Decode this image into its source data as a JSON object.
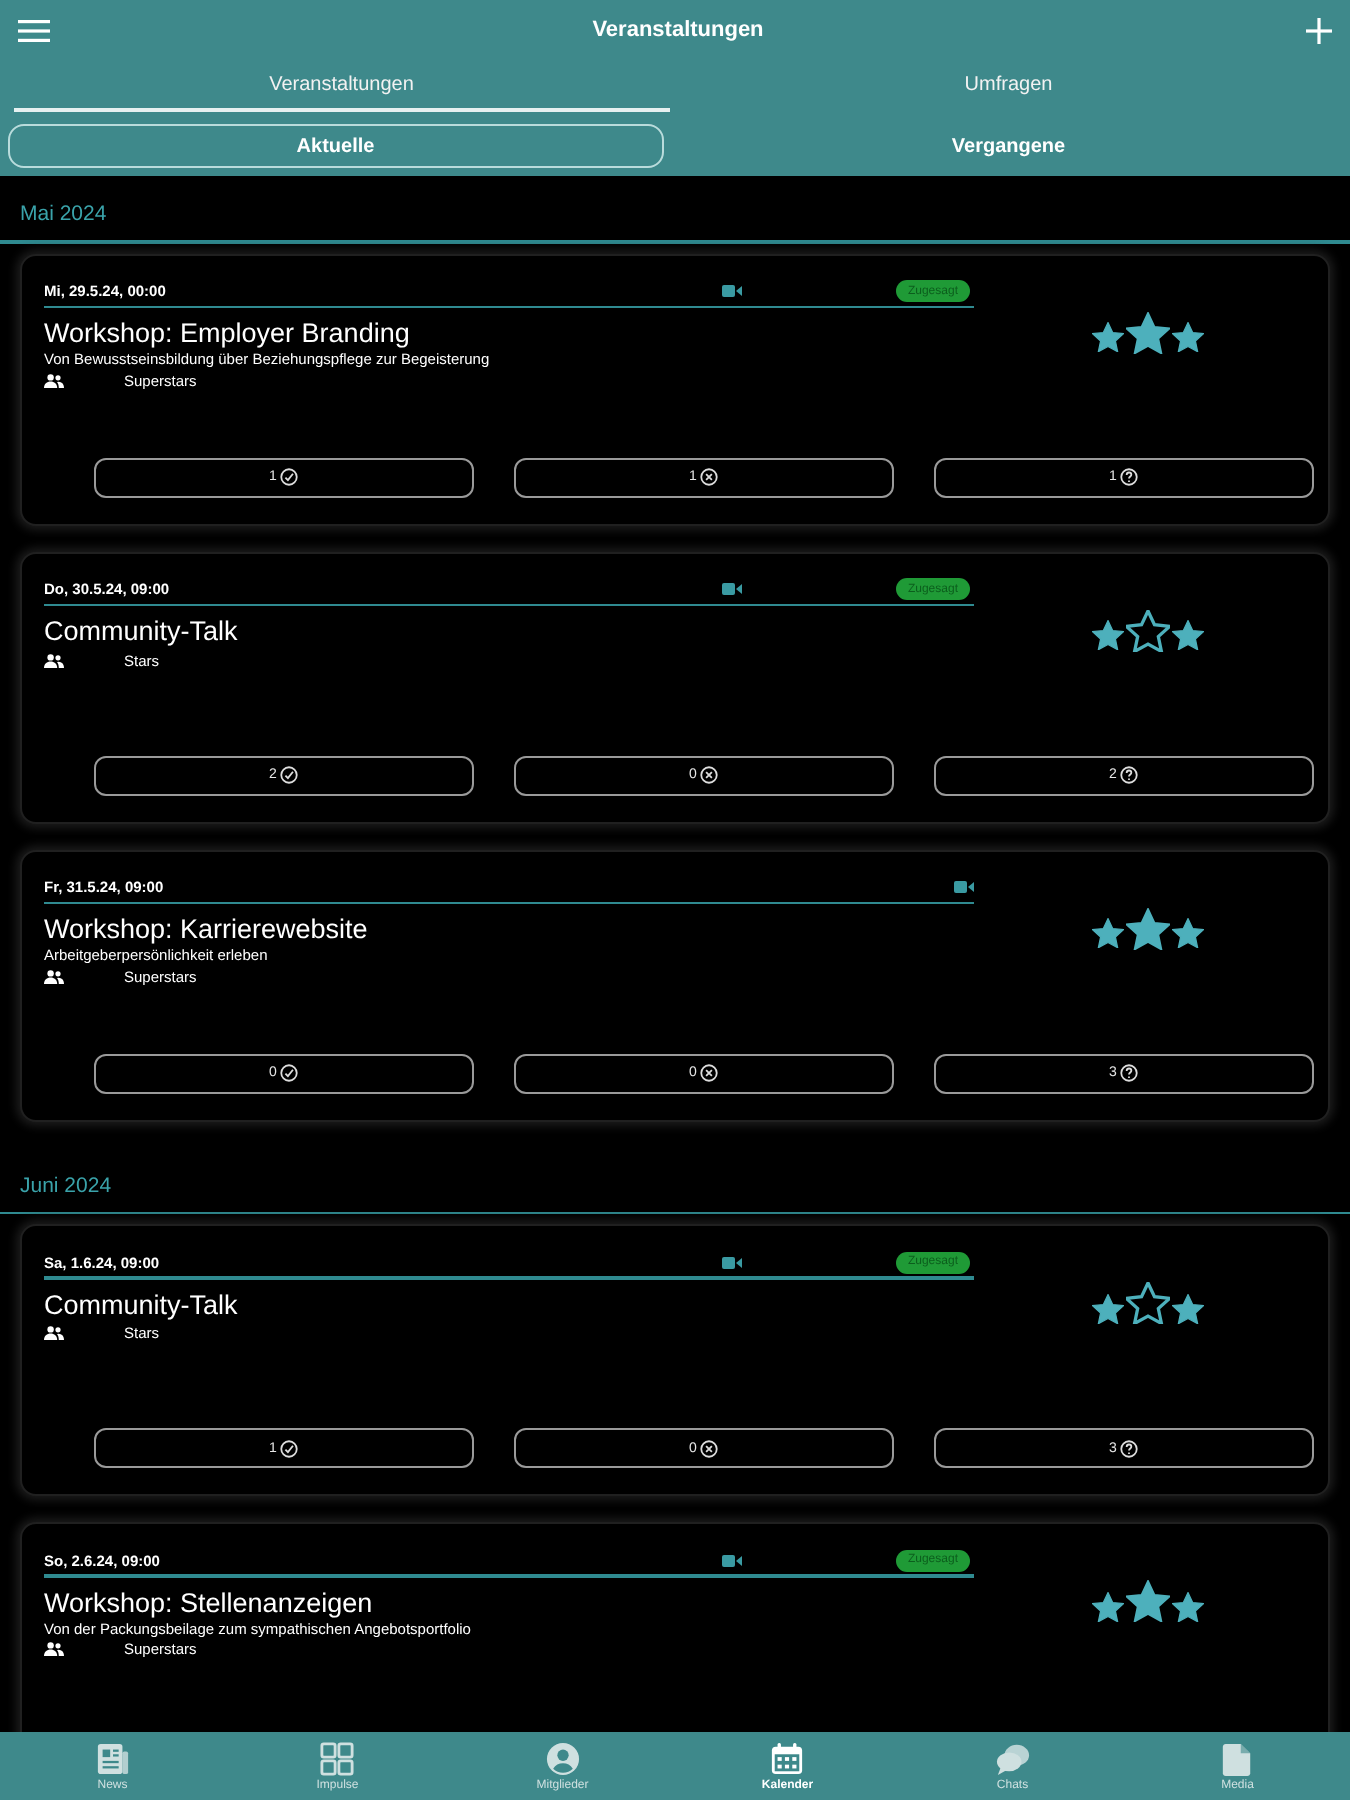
{
  "app_bar": {
    "title": "Veranstaltungen"
  },
  "tabs": [
    {
      "label": "Veranstaltungen",
      "selected": true
    },
    {
      "label": "Umfragen",
      "selected": false
    }
  ],
  "filters": [
    {
      "label": "Aktuelle",
      "selected": true
    },
    {
      "label": "Vergangene",
      "selected": false
    }
  ],
  "sections": [
    {
      "title": "Mai 2024",
      "events": [
        {
          "date": "Mi, 29.5.24, 00:00",
          "online": true,
          "status": "Zugesagt",
          "title": "Workshop: Employer Branding",
          "subtitle": "Von Bewusstseinsbildung über Beziehungspflege zur Begeisterung",
          "group": "Superstars",
          "stars": 3,
          "responses": [
            {
              "kind": "accepted",
              "count": "1"
            },
            {
              "kind": "declined",
              "count": "1"
            },
            {
              "kind": "undecided",
              "count": "1"
            }
          ]
        },
        {
          "date": "Do, 30.5.24, 09:00",
          "online": true,
          "status": "Zugesagt",
          "title": "Community-Talk",
          "group": "Stars",
          "stars": 2,
          "responses": [
            {
              "kind": "accepted",
              "count": "2"
            },
            {
              "kind": "declined",
              "count": "0"
            },
            {
              "kind": "undecided",
              "count": "2"
            }
          ]
        },
        {
          "date": "Fr, 31.5.24, 09:00",
          "online": true,
          "title": "Workshop: Karrierewebsite",
          "subtitle": "Arbeitgeberpersönlichkeit erleben",
          "group": "Superstars",
          "stars": 3,
          "responses": [
            {
              "kind": "accepted",
              "count": "0"
            },
            {
              "kind": "declined",
              "count": "0"
            },
            {
              "kind": "undecided",
              "count": "3"
            }
          ]
        }
      ]
    },
    {
      "title": "Juni 2024",
      "events": [
        {
          "date": "Sa, 1.6.24, 09:00",
          "online": true,
          "status": "Zugesagt",
          "title": "Community-Talk",
          "group": "Stars",
          "stars": 2,
          "responses": [
            {
              "kind": "accepted",
              "count": "1"
            },
            {
              "kind": "declined",
              "count": "0"
            },
            {
              "kind": "undecided",
              "count": "3"
            }
          ]
        },
        {
          "date": "So, 2.6.24, 09:00",
          "online": true,
          "status": "Zugesagt",
          "title": "Workshop: Stellenanzeigen",
          "subtitle": "Von der Packungsbeilage zum sympathischen Angebotsportfolio",
          "group": "Superstars",
          "stars": 3
        }
      ]
    }
  ],
  "bottom_nav": [
    {
      "label": "News",
      "selected": false
    },
    {
      "label": "Impulse",
      "selected": false
    },
    {
      "label": "Mitglieder",
      "selected": false
    },
    {
      "label": "Kalender",
      "selected": true
    },
    {
      "label": "Chats",
      "selected": false
    },
    {
      "label": "Media",
      "selected": false
    }
  ]
}
